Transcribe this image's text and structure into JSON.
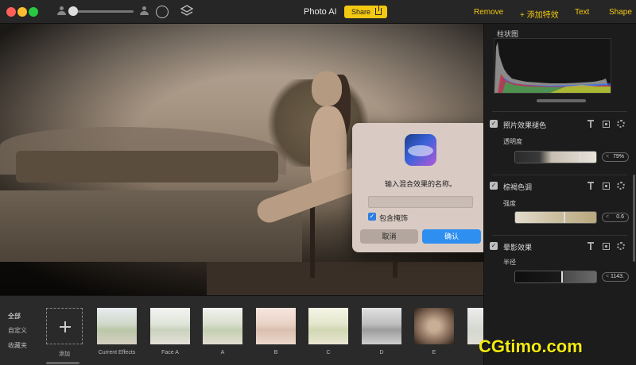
{
  "toolbar": {
    "title": "Photo AI",
    "share_label": "Share",
    "actions": [
      "Remove",
      "+ 添加特效",
      "Text",
      "Shape"
    ]
  },
  "dialog": {
    "title": "输入混合效果的名称。",
    "input_value": "",
    "checkbox_label": "包含掩饰",
    "checkbox_checked": true,
    "cancel_label": "取消",
    "ok_label": "确认"
  },
  "panel": {
    "histogram_title": "柱状图",
    "sections": [
      {
        "title": "照片效果褪色",
        "param": "透明度",
        "value": "79%",
        "fraction": 0.79
      },
      {
        "title": "棕褐色调",
        "param": "强度",
        "value": "0.6",
        "fraction": 0.6
      },
      {
        "title": "晕影效果",
        "param": "半径",
        "value": "1143.",
        "fraction": 0.57
      }
    ]
  },
  "strip": {
    "categories": [
      "全部",
      "自定义",
      "收藏夹"
    ],
    "add_label": "添加",
    "presets": [
      "Current Effects",
      "Face A",
      "A",
      "B",
      "C",
      "D",
      "E"
    ]
  },
  "watermark": "CGtimo.com",
  "colors": {
    "accent": "#f2c811",
    "primary_button": "#2f8ff0"
  }
}
